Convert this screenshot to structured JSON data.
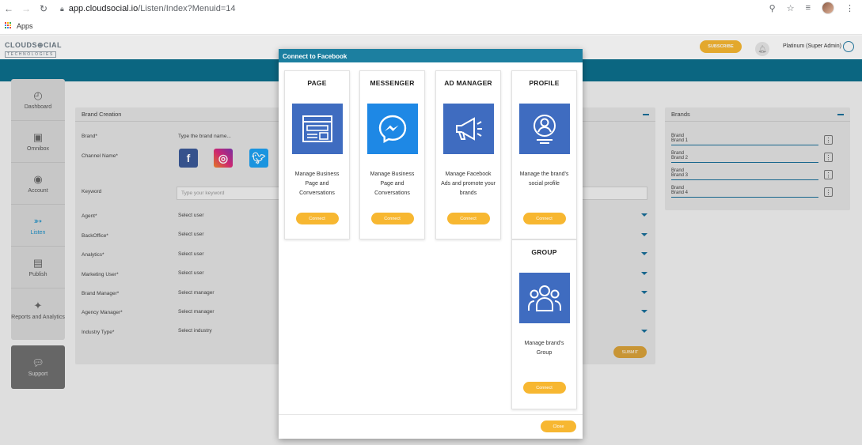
{
  "browser": {
    "url_host": "app.cloudsocial.io",
    "url_path": "/Listen/Index?Menuid=14",
    "bookmarks_label": "Apps"
  },
  "header": {
    "logo_main": "CLOUDS⊕CIAL",
    "logo_sub": "TECHNOLOGIES",
    "subscribe_label": "SUBSCRIBE",
    "user_label": "Platinum (Super Admin)"
  },
  "sidebar": {
    "items": [
      {
        "label": "Dashboard",
        "icon": "dashboard-icon"
      },
      {
        "label": "Omnibox",
        "icon": "omnibox-icon"
      },
      {
        "label": "Account",
        "icon": "account-icon"
      },
      {
        "label": "Listen",
        "icon": "listen-icon"
      },
      {
        "label": "Publish",
        "icon": "publish-icon"
      },
      {
        "label": "Reports and Analytics",
        "icon": "reports-icon"
      }
    ],
    "support_label": "Support"
  },
  "brand_creation": {
    "title": "Brand Creation",
    "brand_label": "Brand*",
    "brand_placeholder": "Type the brand name...",
    "channel_label": "Channel Name*",
    "keyword_label": "Keyword",
    "keyword_placeholder": "Type your keyword",
    "rows": [
      {
        "label": "Agent*",
        "value": "Select user"
      },
      {
        "label": "BackOffice*",
        "value": "Select user"
      },
      {
        "label": "Analytics*",
        "value": "Select user"
      },
      {
        "label": "Marketing User*",
        "value": "Select user"
      },
      {
        "label": "Brand Manager*",
        "value": "Select manager"
      },
      {
        "label": "Agency Manager*",
        "value": "Select manager"
      },
      {
        "label": "Industry Type*",
        "value": "Select industry"
      }
    ],
    "submit_label": "SUBMIT"
  },
  "brands": {
    "title": "Brands",
    "items": [
      {
        "line1": "Brand",
        "line2": "Brand 1"
      },
      {
        "line1": "Brand",
        "line2": "Brand 2"
      },
      {
        "line1": "Brand",
        "line2": "Brand 3"
      },
      {
        "line1": "Brand",
        "line2": "Brand 4"
      }
    ]
  },
  "modal": {
    "title": "Connect to Facebook",
    "cards": [
      {
        "title": "PAGE",
        "desc": "Manage Business Page and Conversations",
        "button": "Connect",
        "icon": "browser-page-icon"
      },
      {
        "title": "MESSENGER",
        "desc": "Manage Business Page and Conversations",
        "button": "Connect",
        "icon": "messenger-icon"
      },
      {
        "title": "AD MANAGER",
        "desc": "Manage Facebook Ads and promote your brands",
        "button": "Connect",
        "icon": "megaphone-icon"
      },
      {
        "title": "PROFILE",
        "desc": "Manage the brand's social profile",
        "button": "Connect",
        "icon": "profile-icon"
      },
      {
        "title": "GROUP",
        "desc": "Manage brand's Group",
        "button": "Connect",
        "icon": "group-icon"
      }
    ],
    "close_label": "Close"
  },
  "colors": {
    "accent_yellow": "#f7b731",
    "teal": "#0d6f8c",
    "card_blue": "#3f6cc0",
    "modal_header": "#1c7fa0"
  }
}
